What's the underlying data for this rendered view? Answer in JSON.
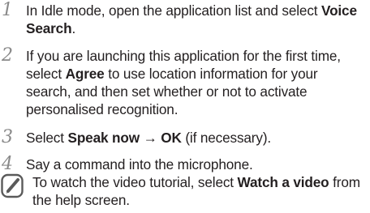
{
  "steps": [
    {
      "number": "1",
      "t1": "In Idle mode, open the application list and select ",
      "b1": "Voice Search",
      "t2": "."
    },
    {
      "number": "2",
      "t1": "If you are launching this application for the first time, select ",
      "b1": "Agree",
      "t2": " to use location information for your search, and then set whether or not to activate personalised recognition."
    },
    {
      "number": "3",
      "t1": "Select ",
      "b1": "Speak now",
      "t2": " → ",
      "b2": "OK",
      "t3": " (if necessary)."
    },
    {
      "number": "4",
      "t1": "Say a command into the microphone."
    }
  ],
  "note": {
    "icon": "note-pencil-icon",
    "t1": "To watch the video tutorial, select ",
    "b1": "Watch a video",
    "t2": " from the help screen."
  },
  "colors": {
    "text": "#231f20",
    "step_number": "#8a8a8a",
    "icon_stroke": "#5a5a5a"
  }
}
